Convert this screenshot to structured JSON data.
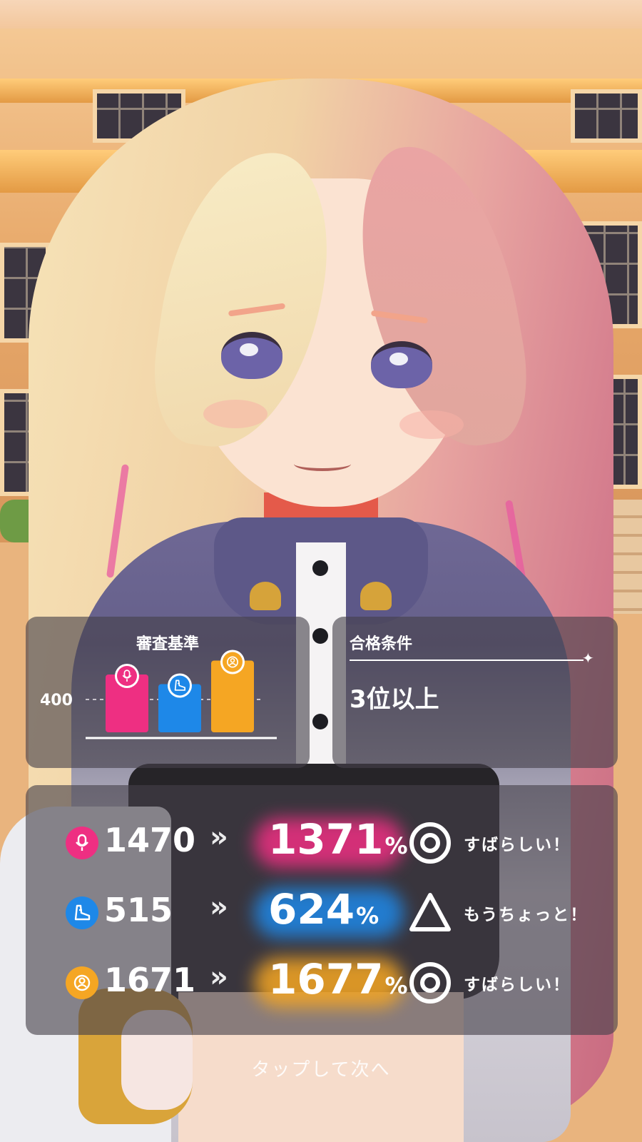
{
  "criteria_panel": {
    "title": "審査基準",
    "axis_label": "400",
    "bars": [
      {
        "attribute": "vocal",
        "icon": "microphone-icon",
        "color": "#ee2f82",
        "level": 0.54
      },
      {
        "attribute": "dance",
        "icon": "shoe-icon",
        "color": "#1e88e8",
        "level": 0.45
      },
      {
        "attribute": "visual",
        "icon": "visual-icon",
        "color": "#f5a623",
        "level": 0.67
      }
    ]
  },
  "condition_panel": {
    "title": "合格条件",
    "value": "3位以上"
  },
  "results": [
    {
      "attribute": "vocal",
      "icon": "microphone-icon",
      "color": "#ee2f82",
      "value": "1470",
      "arrow": "»",
      "percent": "1371",
      "unit": "%",
      "grade_icon": "double-circle-icon",
      "comment": "すばらしい！"
    },
    {
      "attribute": "dance",
      "icon": "shoe-icon",
      "color": "#1e88e8",
      "value": "515",
      "arrow": "»",
      "percent": "624",
      "unit": "%",
      "grade_icon": "triangle-icon",
      "comment": "もうちょっと！"
    },
    {
      "attribute": "visual",
      "icon": "visual-icon",
      "color": "#f5a623",
      "value": "1671",
      "arrow": "»",
      "percent": "1677",
      "unit": "%",
      "grade_icon": "double-circle-icon",
      "comment": "すばらしい！"
    }
  ],
  "footer": {
    "tap_next": "タップして次へ"
  }
}
